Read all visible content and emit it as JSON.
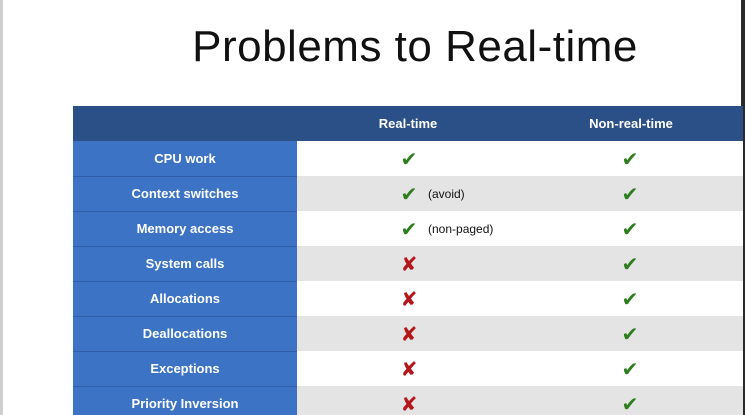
{
  "slide": {
    "title": "Problems to Real-time"
  },
  "colors": {
    "header_bg": "#2b4f87",
    "label_bg": "#3d73c4",
    "check": "#2e7d1e",
    "cross": "#b3161b",
    "row_shade": "#e4e4e4"
  },
  "table": {
    "headers": [
      "",
      "Real-time",
      "Non-real-time"
    ],
    "rows": [
      {
        "label": "CPU work",
        "rt_mark": "check",
        "rt_note": "",
        "nrt_mark": "check"
      },
      {
        "label": "Context switches",
        "rt_mark": "check",
        "rt_note": "(avoid)",
        "nrt_mark": "check"
      },
      {
        "label": "Memory access",
        "rt_mark": "check",
        "rt_note": "(non-paged)",
        "nrt_mark": "check"
      },
      {
        "label": "System calls",
        "rt_mark": "cross",
        "rt_note": "",
        "nrt_mark": "check"
      },
      {
        "label": "Allocations",
        "rt_mark": "cross",
        "rt_note": "",
        "nrt_mark": "check"
      },
      {
        "label": "Deallocations",
        "rt_mark": "cross",
        "rt_note": "",
        "nrt_mark": "check"
      },
      {
        "label": "Exceptions",
        "rt_mark": "cross",
        "rt_note": "",
        "nrt_mark": "check"
      },
      {
        "label": "Priority Inversion",
        "rt_mark": "cross",
        "rt_note": "",
        "nrt_mark": "check"
      }
    ]
  },
  "icons": {
    "check": "check-icon",
    "cross": "cross-icon"
  }
}
